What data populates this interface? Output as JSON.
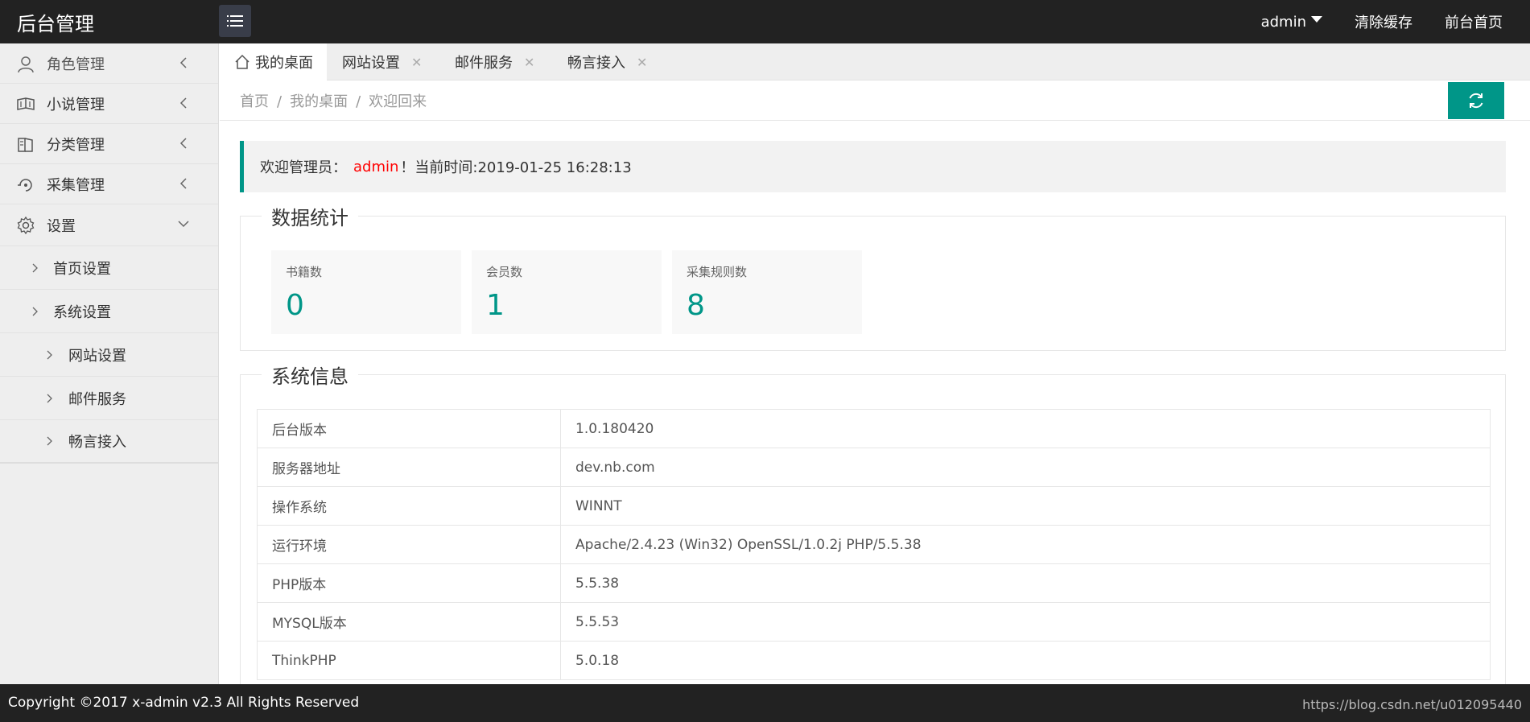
{
  "header": {
    "logo": "后台管理",
    "user": "admin",
    "clear_cache": "清除缓存",
    "front_home": "前台首页"
  },
  "sidebar": {
    "items": [
      {
        "label": "角色管理",
        "icon": "user-icon"
      },
      {
        "label": "小说管理",
        "icon": "book-icon"
      },
      {
        "label": "分类管理",
        "icon": "category-icon"
      },
      {
        "label": "采集管理",
        "icon": "collect-icon"
      },
      {
        "label": "设置",
        "icon": "gear-icon"
      }
    ],
    "sub_items": [
      {
        "label": "首页设置"
      },
      {
        "label": "系统设置"
      },
      {
        "label": "网站设置"
      },
      {
        "label": "邮件服务"
      },
      {
        "label": "畅言接入"
      }
    ]
  },
  "tabs": [
    {
      "label": "我的桌面"
    },
    {
      "label": "网站设置"
    },
    {
      "label": "邮件服务"
    },
    {
      "label": "畅言接入"
    }
  ],
  "tab_close": "✕",
  "breadcrumb": {
    "items": [
      "首页",
      "我的桌面",
      "欢迎回来"
    ],
    "sep": "/"
  },
  "welcome": {
    "prefix": "欢迎管理员：",
    "admin": "admin",
    "suffix": "！当前时间:2019-01-25 16:28:13"
  },
  "stats": {
    "title": "数据统计",
    "cards": [
      {
        "label": "书籍数",
        "value": "0"
      },
      {
        "label": "会员数",
        "value": "1"
      },
      {
        "label": "采集规则数",
        "value": "8"
      }
    ]
  },
  "sysinfo": {
    "title": "系统信息",
    "rows": [
      {
        "k": "后台版本",
        "v": "1.0.180420"
      },
      {
        "k": "服务器地址",
        "v": "dev.nb.com"
      },
      {
        "k": "操作系统",
        "v": "WINNT"
      },
      {
        "k": "运行环境",
        "v": "Apache/2.4.23 (Win32) OpenSSL/1.0.2j PHP/5.5.38"
      },
      {
        "k": "PHP版本",
        "v": "5.5.38"
      },
      {
        "k": "MYSQL版本",
        "v": "5.5.53"
      },
      {
        "k": "ThinkPHP",
        "v": "5.0.18"
      }
    ]
  },
  "footer": {
    "copyright": "Copyright ©2017 x-admin v2.3 All Rights Reserved",
    "url": "https://blog.csdn.net/u012095440"
  },
  "colors": {
    "accent": "#009688",
    "header_bg": "#222222",
    "sidebar_bg": "#EEEEEE",
    "admin_red": "#FF0000"
  }
}
